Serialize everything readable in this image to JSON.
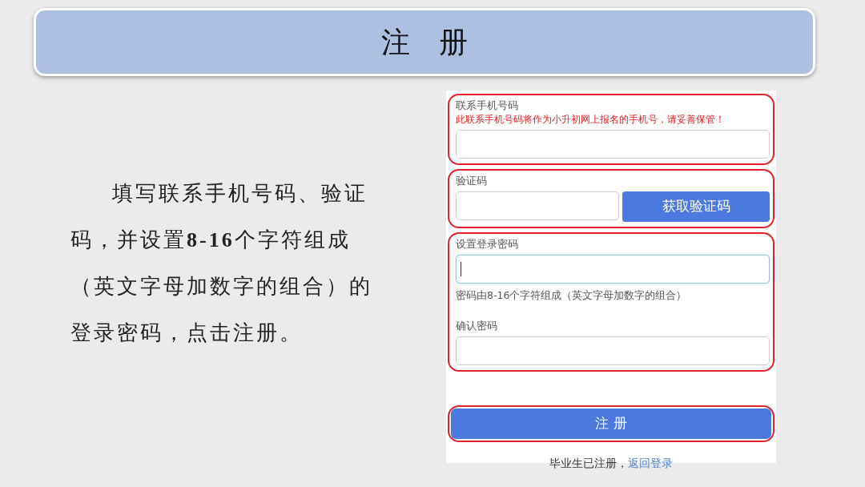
{
  "slide": {
    "title": "注　册",
    "instruction": "填写联系手机号码、验证码，并设置**8-16**个字符组成（英文字母加数字的组合）的登录密码，点击注册。"
  },
  "sections": [
    {
      "kind": "phone",
      "highlighted": true,
      "label": "联系手机号码",
      "notice": "此联系手机号码将作为小升初网上报名的手机号，请妥善保管！"
    },
    {
      "kind": "code",
      "highlighted": true,
      "label": "验证码",
      "button": "获取验证码"
    },
    {
      "kind": "password",
      "highlighted": true,
      "label": "设置登录密码",
      "focused": true,
      "hint": "密码由8-16个字符组成（英文字母加数字的组合）",
      "confirm_label": "确认密码"
    },
    {
      "kind": "submit",
      "highlighted": true,
      "button": "注 册"
    }
  ],
  "footer": {
    "text": "毕业生已注册，",
    "link": "返回登录"
  }
}
